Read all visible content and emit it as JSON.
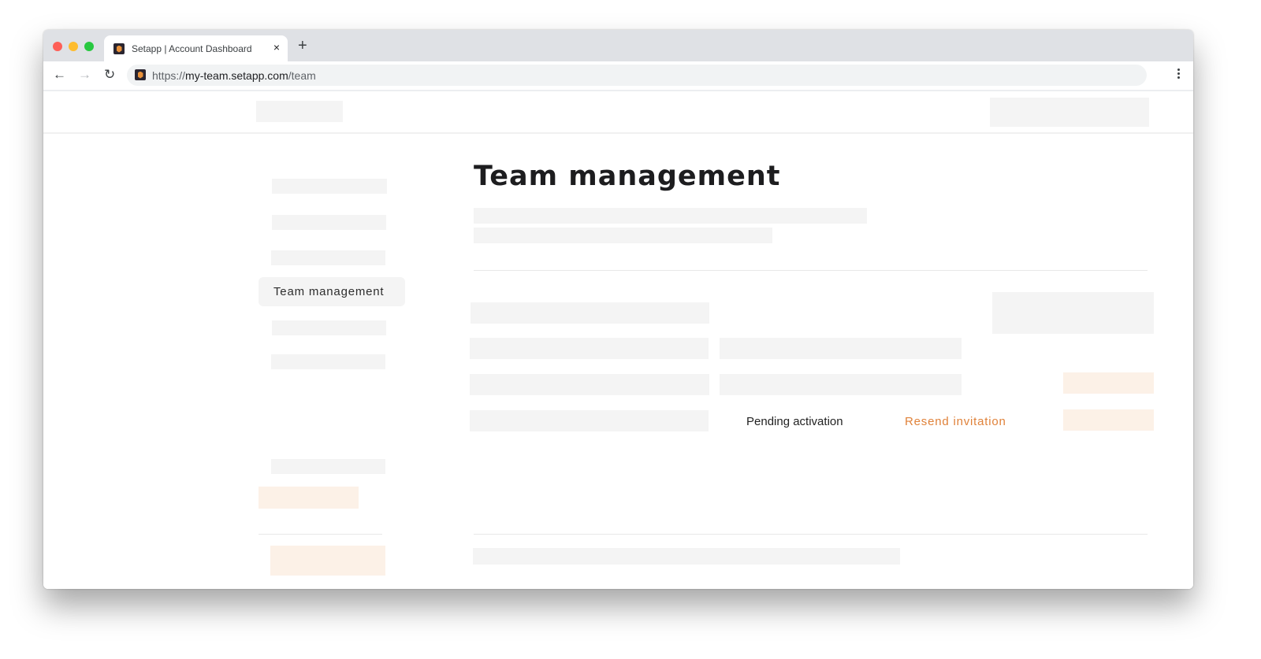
{
  "browser": {
    "tab": {
      "title": "Setapp | Account Dashboard",
      "favicon": "setapp-logo-icon",
      "close_icon": "×"
    },
    "new_tab_icon": "+",
    "nav": {
      "back_icon": "←",
      "forward_icon": "→",
      "reload_icon": "↻"
    },
    "url": {
      "scheme": "https://",
      "host": "my-team.setapp.com",
      "path": "/team"
    },
    "menu_icon": "kebab-menu-icon"
  },
  "page": {
    "title": "Team management",
    "sidebar": {
      "active_item": "Team management"
    },
    "members": {
      "status": "Pending activation",
      "resend_label": "Resend invitation"
    },
    "colors": {
      "accent": "#e0823a",
      "placeholder": "#f4f4f4",
      "accent_placeholder": "#fcf1e7"
    }
  }
}
